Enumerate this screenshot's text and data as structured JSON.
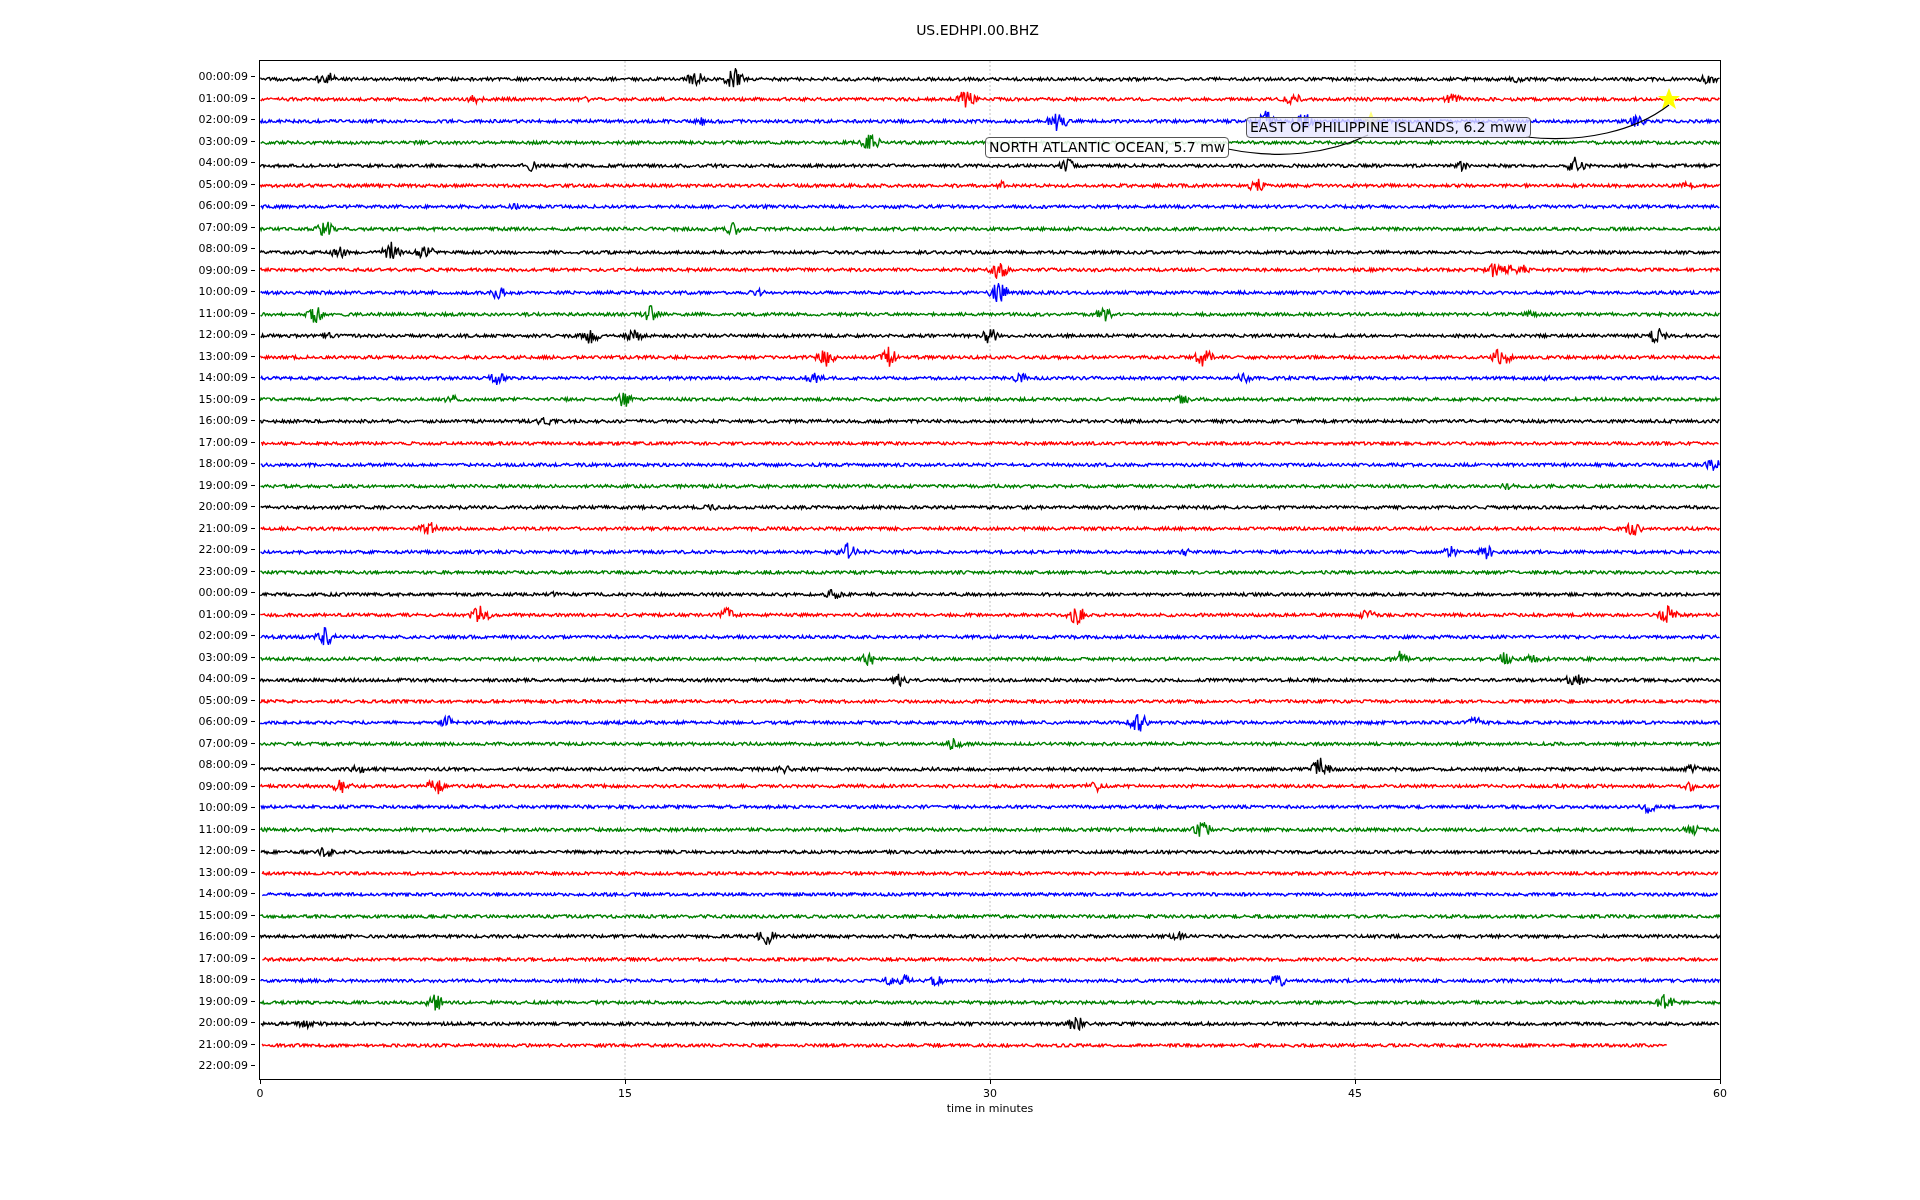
{
  "title": "US.EDHPI.00.BHZ",
  "traces": [
    {
      "label": "00:00:09",
      "color": "#000000",
      "level": 1
    },
    {
      "label": "01:00:09",
      "color": "#ff0000",
      "level": 1
    },
    {
      "label": "02:00:09",
      "color": "#0000ff",
      "level": 1
    },
    {
      "label": "03:00:09",
      "color": "#008000",
      "level": 1
    },
    {
      "label": "04:00:09",
      "color": "#000000",
      "level": 1
    },
    {
      "label": "05:00:09",
      "color": "#ff0000",
      "level": 1
    },
    {
      "label": "06:00:09",
      "color": "#0000ff",
      "level": 1
    },
    {
      "label": "07:00:09",
      "color": "#008000",
      "level": 1
    },
    {
      "label": "08:00:09",
      "color": "#000000",
      "level": 1
    },
    {
      "label": "09:00:09",
      "color": "#ff0000",
      "level": 1
    },
    {
      "label": "10:00:09",
      "color": "#0000ff",
      "level": 1
    },
    {
      "label": "11:00:09",
      "color": "#008000",
      "level": 1
    },
    {
      "label": "12:00:09",
      "color": "#000000",
      "level": 1
    },
    {
      "label": "13:00:09",
      "color": "#ff0000",
      "level": 1
    },
    {
      "label": "14:00:09",
      "color": "#0000ff",
      "level": 1
    },
    {
      "label": "15:00:09",
      "color": "#008000",
      "level": 1
    },
    {
      "label": "16:00:09",
      "color": "#000000",
      "level": 1
    },
    {
      "label": "17:00:09",
      "color": "#ff0000",
      "level": 1
    },
    {
      "label": "18:00:09",
      "color": "#0000ff",
      "level": 1
    },
    {
      "label": "19:00:09",
      "color": "#008000",
      "level": 1
    },
    {
      "label": "20:00:09",
      "color": "#000000",
      "level": 1
    },
    {
      "label": "21:00:09",
      "color": "#ff0000",
      "level": 1
    },
    {
      "label": "22:00:09",
      "color": "#0000ff",
      "level": 1
    },
    {
      "label": "23:00:09",
      "color": "#008000",
      "level": 1
    },
    {
      "label": "00:00:09",
      "color": "#000000",
      "level": 1
    },
    {
      "label": "01:00:09",
      "color": "#ff0000",
      "level": 1
    },
    {
      "label": "02:00:09",
      "color": "#0000ff",
      "level": 1
    },
    {
      "label": "03:00:09",
      "color": "#008000",
      "level": 1
    },
    {
      "label": "04:00:09",
      "color": "#000000",
      "level": 1
    },
    {
      "label": "05:00:09",
      "color": "#ff0000",
      "level": 1
    },
    {
      "label": "06:00:09",
      "color": "#0000ff",
      "level": 1
    },
    {
      "label": "07:00:09",
      "color": "#008000",
      "level": 1
    },
    {
      "label": "08:00:09",
      "color": "#000000",
      "level": 1
    },
    {
      "label": "09:00:09",
      "color": "#ff0000",
      "level": 1
    },
    {
      "label": "10:00:09",
      "color": "#0000ff",
      "level": 1
    },
    {
      "label": "11:00:09",
      "color": "#008000",
      "level": 1
    },
    {
      "label": "12:00:09",
      "color": "#000000",
      "level": 1
    },
    {
      "label": "13:00:09",
      "color": "#ff0000",
      "level": 1
    },
    {
      "label": "14:00:09",
      "color": "#0000ff",
      "level": 1
    },
    {
      "label": "15:00:09",
      "color": "#008000",
      "level": 1
    },
    {
      "label": "16:00:09",
      "color": "#000000",
      "level": 1
    },
    {
      "label": "17:00:09",
      "color": "#ff0000",
      "level": 1
    },
    {
      "label": "18:00:09",
      "color": "#0000ff",
      "level": 1
    },
    {
      "label": "19:00:09",
      "color": "#008000",
      "level": 1
    },
    {
      "label": "20:00:09",
      "color": "#000000",
      "level": 1
    },
    {
      "label": "21:00:09",
      "color": "#ff0000",
      "level": 0.965
    },
    {
      "label": "22:00:09"
    }
  ],
  "x_axis": {
    "label": "time in minutes",
    "ticks": [
      "0",
      "15",
      "30",
      "45",
      "60"
    ]
  },
  "annotations": [
    {
      "text": "EAST OF PHILIPPINE ISLANDS, 6.2 mww"
    },
    {
      "text": "NORTH ATLANTIC OCEAN, 5.7 mw"
    }
  ]
}
